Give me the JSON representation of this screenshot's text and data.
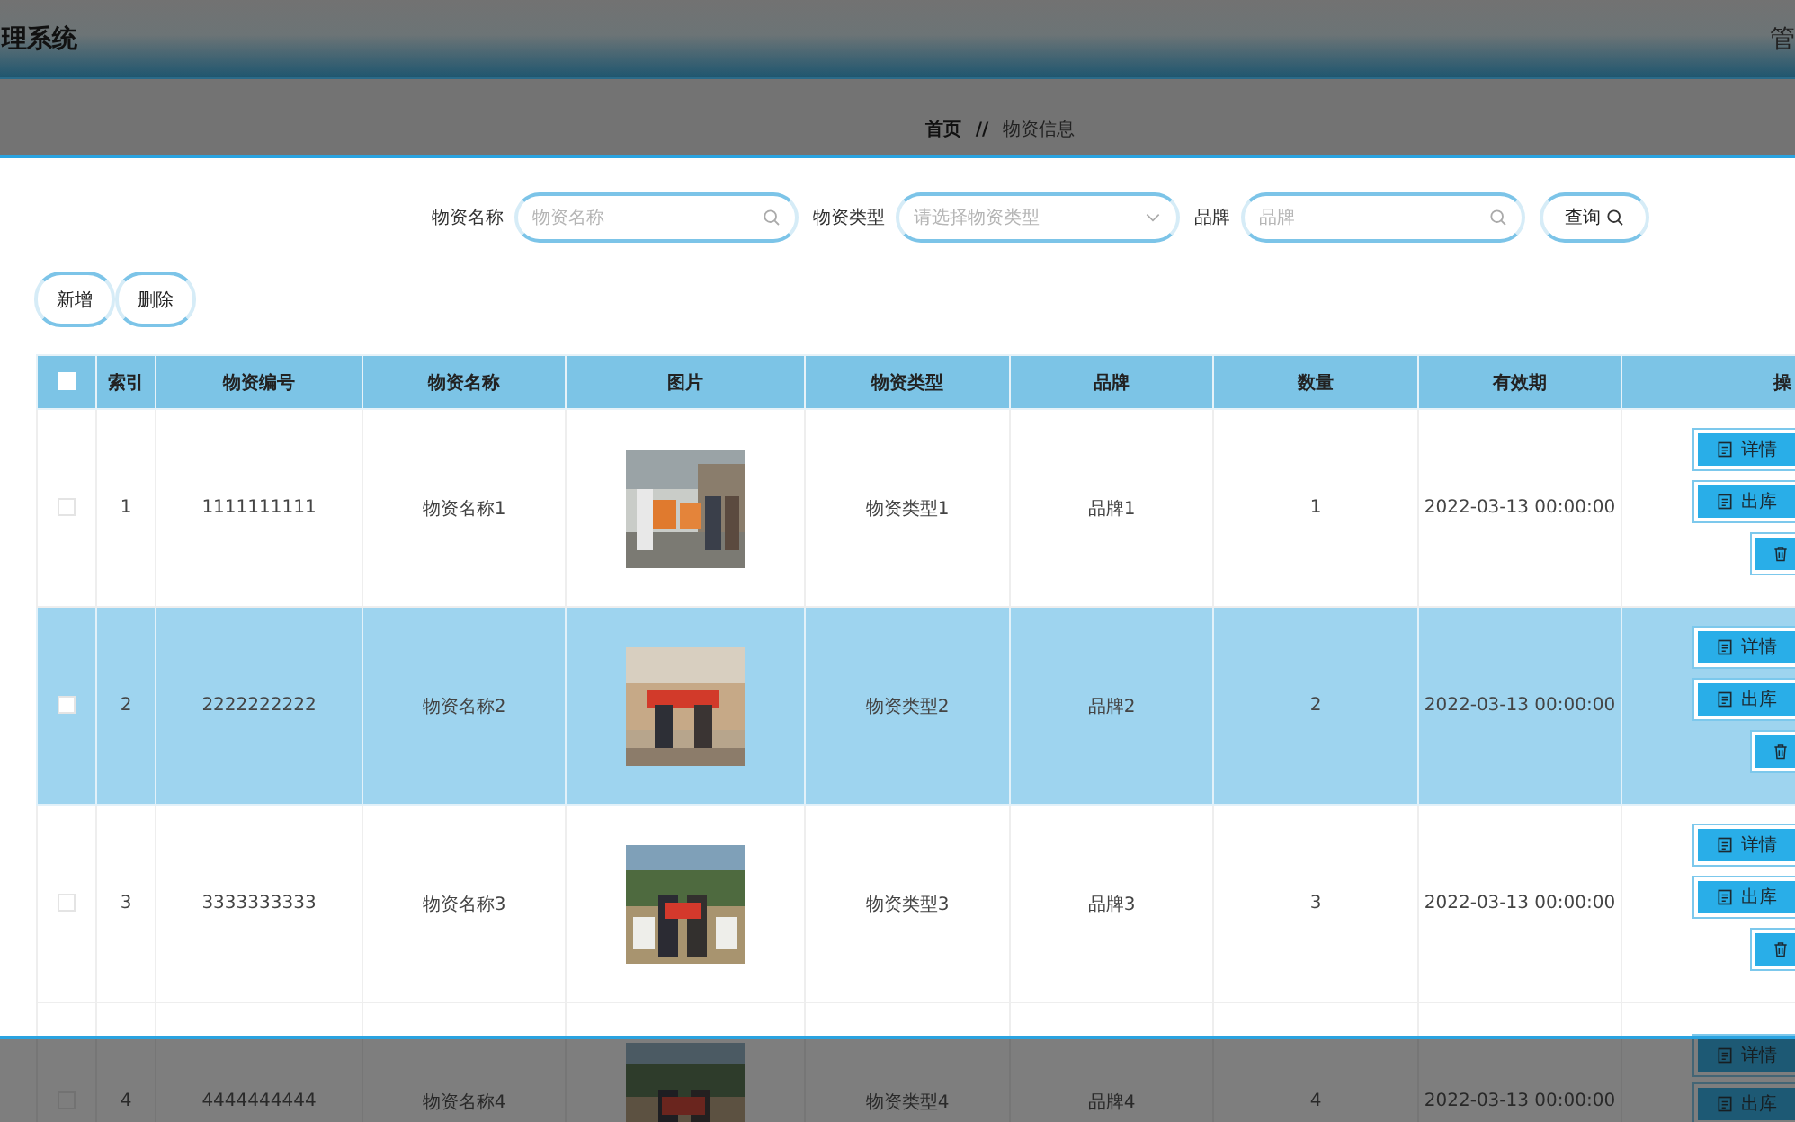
{
  "header": {
    "title": "理系统",
    "user": "管"
  },
  "breadcrumb": {
    "items": [
      "首页",
      "物资信息"
    ],
    "separator": "//"
  },
  "search": {
    "fields": [
      {
        "label": "物资名称",
        "kind": "text",
        "placeholder": "物资名称"
      },
      {
        "label": "物资类型",
        "kind": "select",
        "placeholder": "请选择物资类型"
      },
      {
        "label": "品牌",
        "kind": "text",
        "placeholder": "品牌"
      }
    ],
    "button": "查询"
  },
  "actions": [
    "新增",
    "删除"
  ],
  "table": {
    "select_all": {
      "checked": false
    },
    "columns": [
      "索引",
      "物资编号",
      "物资名称",
      "图片",
      "物资类型",
      "品牌",
      "数量",
      "有效期",
      "操"
    ],
    "rows": [
      {
        "selected": false,
        "checked": false,
        "index": "1",
        "code": "1111111111",
        "name": "物资名称1",
        "type": "物资类型1",
        "brand": "品牌1",
        "quantity": "1",
        "expiry": "2022-03-13 00:00:00",
        "buttons": [
          "详情",
          "出库"
        ],
        "delete_icon": true
      },
      {
        "selected": true,
        "checked": false,
        "index": "2",
        "code": "2222222222",
        "name": "物资名称2",
        "type": "物资类型2",
        "brand": "品牌2",
        "quantity": "2",
        "expiry": "2022-03-13 00:00:00",
        "buttons": [
          "详情",
          "出库"
        ],
        "delete_icon": true
      },
      {
        "selected": false,
        "checked": false,
        "index": "3",
        "code": "3333333333",
        "name": "物资名称3",
        "type": "物资类型3",
        "brand": "品牌3",
        "quantity": "3",
        "expiry": "2022-03-13 00:00:00",
        "buttons": [
          "详情",
          "出库"
        ],
        "delete_icon": true
      },
      {
        "selected": false,
        "checked": false,
        "index": "4",
        "code": "4444444444",
        "name": "物资名称4",
        "type": "物资类型4",
        "brand": "品牌4",
        "quantity": "4",
        "expiry": "2022-03-13 00:00:00",
        "buttons": [
          "详情",
          "出库"
        ],
        "delete_icon": false
      }
    ]
  }
}
